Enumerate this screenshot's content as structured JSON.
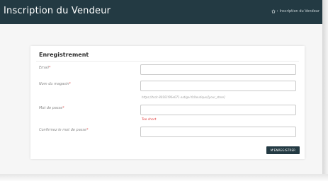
{
  "header": {
    "title": "Inscription du Vendeur",
    "breadcrumb": {
      "separator": "›",
      "current": "Inscription du Vendeur"
    }
  },
  "form": {
    "section_title": "Enregistrement",
    "required_marker": "*",
    "fields": [
      {
        "label": "Email",
        "value": ""
      },
      {
        "label": "Nom du magasin",
        "value": "",
        "help": "https://tcdc-80101f96e071.eatigel.fr/boutique/[your_store]"
      },
      {
        "label": "Mot de passe",
        "value": "",
        "error": "Too short"
      },
      {
        "label": "Confirmez le mot de passe",
        "value": ""
      }
    ],
    "submit_label": "M'ENREGISTRER"
  },
  "colors": {
    "header_bg": "#233a43",
    "error": "#e03a3a",
    "required": "#e05555"
  },
  "icons": {
    "breadcrumb_home": "home-icon"
  }
}
